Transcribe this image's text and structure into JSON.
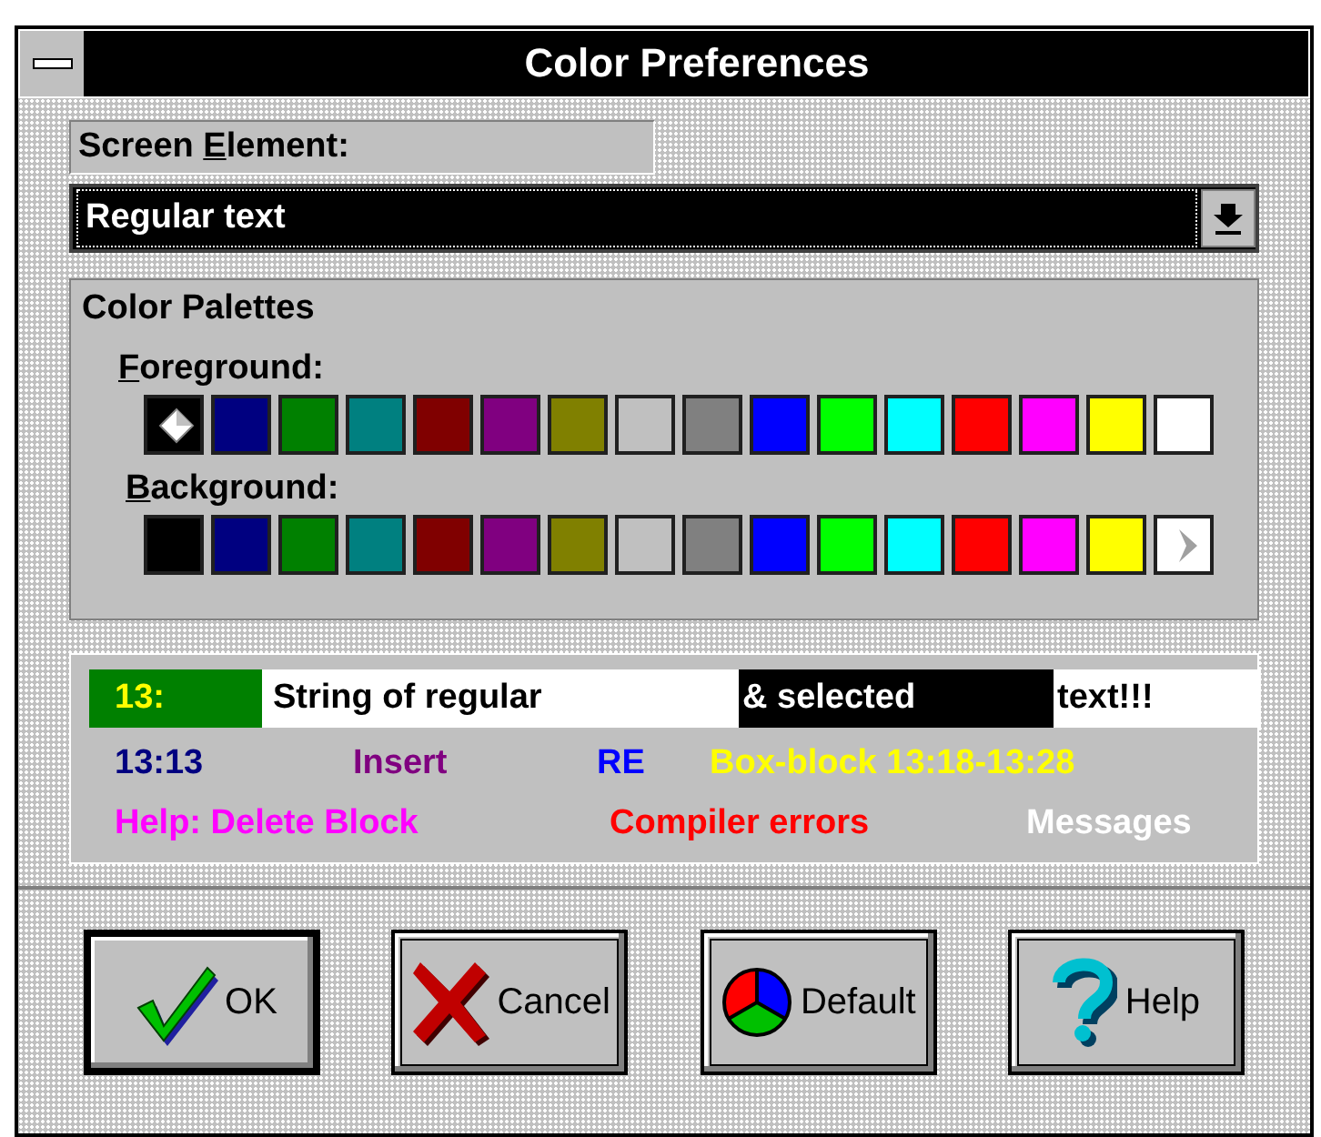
{
  "window": {
    "title": "Color Preferences"
  },
  "screen_element": {
    "label": {
      "before": "Screen ",
      "accel": "E",
      "rest": "lement:"
    },
    "value": "Regular text"
  },
  "palettes_group": {
    "title": "Color Palettes",
    "palettes": [
      {
        "kind": "foreground",
        "label": {
          "accel": "F",
          "rest": "oreground:"
        },
        "swatches": [
          {
            "color": "#000000",
            "selected": true
          },
          {
            "color": "#000080",
            "selected": false
          },
          {
            "color": "#008000",
            "selected": false
          },
          {
            "color": "#008080",
            "selected": false
          },
          {
            "color": "#800000",
            "selected": false
          },
          {
            "color": "#800080",
            "selected": false
          },
          {
            "color": "#808000",
            "selected": false
          },
          {
            "color": "#c0c0c0",
            "selected": false
          },
          {
            "color": "#808080",
            "selected": false
          },
          {
            "color": "#0000ff",
            "selected": false
          },
          {
            "color": "#00ff00",
            "selected": false
          },
          {
            "color": "#00ffff",
            "selected": false
          },
          {
            "color": "#ff0000",
            "selected": false
          },
          {
            "color": "#ff00ff",
            "selected": false
          },
          {
            "color": "#ffff00",
            "selected": false
          },
          {
            "color": "#ffffff",
            "selected": false
          }
        ]
      },
      {
        "kind": "background",
        "label": {
          "accel": "B",
          "rest": "ackground:"
        },
        "swatches": [
          {
            "color": "#000000",
            "selected": false
          },
          {
            "color": "#000080",
            "selected": false
          },
          {
            "color": "#008000",
            "selected": false
          },
          {
            "color": "#008080",
            "selected": false
          },
          {
            "color": "#800000",
            "selected": false
          },
          {
            "color": "#800080",
            "selected": false
          },
          {
            "color": "#808000",
            "selected": false
          },
          {
            "color": "#c0c0c0",
            "selected": false
          },
          {
            "color": "#808080",
            "selected": false
          },
          {
            "color": "#0000ff",
            "selected": false
          },
          {
            "color": "#00ff00",
            "selected": false
          },
          {
            "color": "#00ffff",
            "selected": false
          },
          {
            "color": "#ff0000",
            "selected": false
          },
          {
            "color": "#ff00ff",
            "selected": false
          },
          {
            "color": "#ffff00",
            "selected": false
          },
          {
            "color": "#ffffff",
            "selected": true
          }
        ]
      }
    ]
  },
  "preview": {
    "lines": [
      [
        {
          "text": "13:",
          "color": "#ffff00",
          "kind": "line_number"
        },
        {
          "text": "String of regular",
          "color": "#000000",
          "kind": "normal"
        },
        {
          "text": "& selected",
          "color": "#ffffff",
          "kind": "selected"
        },
        {
          "text": "text!!!",
          "color": "#000000",
          "kind": "normal"
        }
      ],
      [
        {
          "text": "13:13",
          "color": "#000080"
        },
        {
          "text": "Insert",
          "color": "#800080"
        },
        {
          "text": "RE",
          "color": "#0000ff"
        },
        {
          "text": "Box-block 13:18-13:28",
          "color": "#ffff00"
        }
      ],
      [
        {
          "text": "Help: Delete Block",
          "color": "#ff00ff"
        },
        {
          "text": "Compiler errors",
          "color": "#ff0000"
        },
        {
          "text": "Messages",
          "color": "#ffffff"
        }
      ]
    ]
  },
  "buttons": [
    {
      "kind": "ok",
      "label": "OK",
      "is_default": true
    },
    {
      "kind": "cancel",
      "label": "Cancel",
      "is_default": false
    },
    {
      "kind": "default",
      "label": "Default",
      "is_default": false
    },
    {
      "kind": "help",
      "label": "Help",
      "is_default": false
    }
  ]
}
